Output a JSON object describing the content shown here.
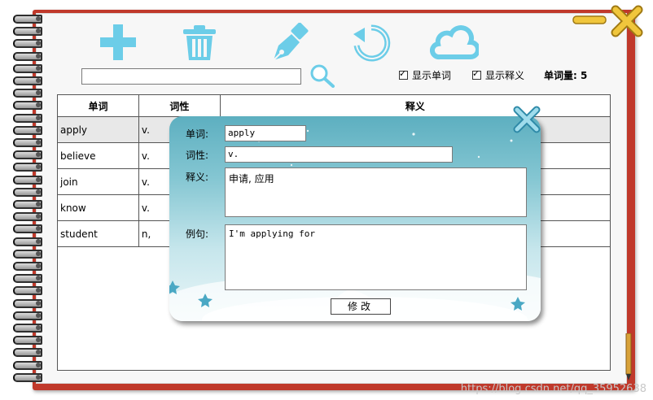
{
  "toolbar": {
    "add_icon": "plus-icon",
    "delete_icon": "trash-icon",
    "edit_icon": "pen-nib-icon",
    "refresh_icon": "refresh-icon",
    "cloud_icon": "cloud-icon"
  },
  "search": {
    "value": "",
    "placeholder": ""
  },
  "options": {
    "show_word_label": "显示单词",
    "show_word_checked": true,
    "show_meaning_label": "显示释义",
    "show_meaning_checked": true,
    "count_label": "单词量:",
    "count_value": "5"
  },
  "table": {
    "headers": [
      "单词",
      "词性",
      "释义"
    ],
    "rows": [
      {
        "word": "apply",
        "pos": "v.",
        "meaning": ""
      },
      {
        "word": "believe",
        "pos": "v.",
        "meaning": ""
      },
      {
        "word": "join",
        "pos": "v.",
        "meaning": ""
      },
      {
        "word": "know",
        "pos": "v.",
        "meaning": ""
      },
      {
        "word": "student",
        "pos": "n,",
        "meaning": ""
      }
    ]
  },
  "dialog": {
    "word_label": "单词:",
    "word_value": "apply",
    "pos_label": "词性:",
    "pos_value": "v.",
    "meaning_label": "释义:",
    "meaning_value": "申请, 应用",
    "example_label": "例句:",
    "example_value": "I'm applying for",
    "modify_label": "修改"
  },
  "watermark": "https://blog.csdn.net/qq_35952638",
  "colors": {
    "accent_icon": "#6ccde8",
    "book_cover": "#c0392b",
    "window_control": "#e6b833"
  }
}
